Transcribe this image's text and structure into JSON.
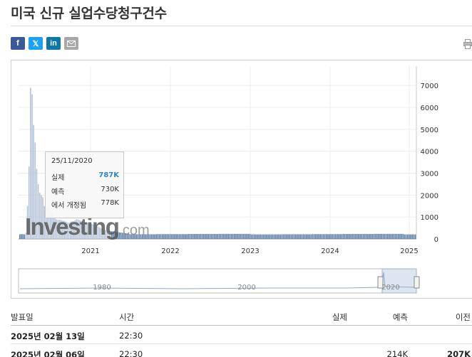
{
  "page_title": "미국 신규 실업수당청구건수",
  "share": {
    "facebook": "f",
    "twitter": "𝕏",
    "linkedin": "in"
  },
  "logo": {
    "brand": "Investing",
    "suffix": ".com"
  },
  "tooltip": {
    "date": "25/11/2020",
    "actual_label": "실제",
    "actual_value": "787K",
    "forecast_label": "예측",
    "forecast_value": "730K",
    "revised_label": "에서 개정됨",
    "revised_value": "778K"
  },
  "navigator": {
    "labels": [
      "1980",
      "2000",
      "2020"
    ]
  },
  "table": {
    "headers": {
      "date": "발표일",
      "time": "시간",
      "actual": "실제",
      "forecast": "예측",
      "previous": "이전"
    },
    "rows": [
      {
        "date": "2025년 02월 13일",
        "time": "22:30",
        "actual": "",
        "forecast": "",
        "previous": ""
      },
      {
        "date": "2025년 02월 06일",
        "time": "22:30",
        "actual": "",
        "forecast": "214K",
        "previous": "207K"
      }
    ]
  },
  "colors": {
    "bar": "#5b7fa8",
    "bar_light": "#b5c4d8",
    "accent": "#2e83c5"
  },
  "chart_data": {
    "type": "bar",
    "title": "",
    "xlabel": "",
    "ylabel": "",
    "ylim": [
      0,
      7500
    ],
    "yticks": [
      0,
      1000,
      2000,
      3000,
      4000,
      5000,
      6000,
      7000
    ],
    "xticks": [
      "2021",
      "2022",
      "2023",
      "2024",
      "2025"
    ],
    "grid": true,
    "series": [
      {
        "values_k": [
          210,
          220,
          215,
          210,
          280,
          1500,
          3300,
          6900,
          6600,
          5200,
          4400,
          3200,
          2500,
          2100,
          2000,
          1900,
          1500,
          1400,
          1480,
          1430,
          1300,
          1200,
          1100,
          1000,
          900,
          870,
          880,
          860,
          840,
          820,
          790,
          760,
          740,
          790,
          800,
          810,
          850,
          900,
          880,
          860,
          830,
          800,
          770,
          740,
          730,
          720,
          700,
          680,
          660,
          630,
          600,
          560,
          530,
          500,
          470,
          440,
          410,
          380,
          370,
          360,
          350,
          350,
          340,
          330,
          310,
          300,
          290,
          280,
          270,
          260,
          250,
          240
        ]
      }
    ],
    "tail_level_k": 220
  }
}
